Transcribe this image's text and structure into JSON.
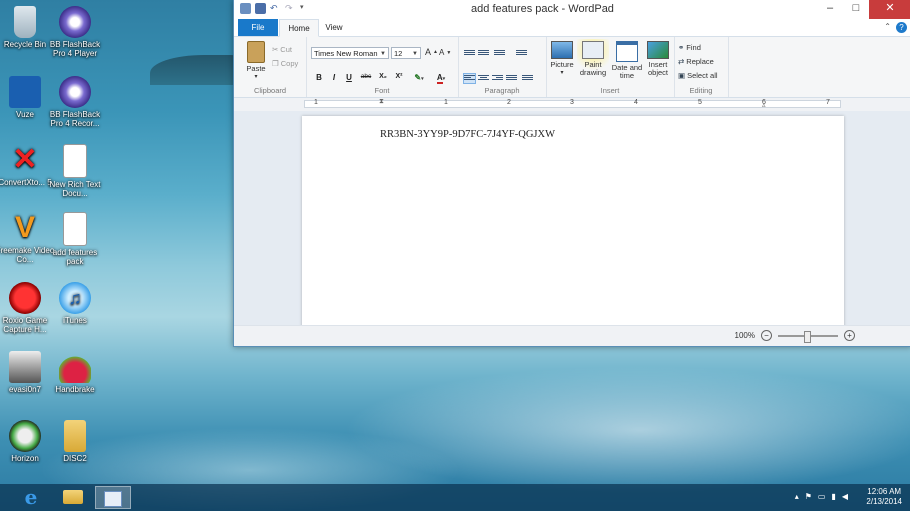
{
  "desktop": {
    "icons": [
      {
        "label": "Recycle Bin"
      },
      {
        "label": "BB FlashBack Pro 4 Player"
      },
      {
        "label": "Vuze"
      },
      {
        "label": "BB FlashBack Pro 4 Recor..."
      },
      {
        "label": "ConvertXto... 5"
      },
      {
        "label": "New Rich Text Docu..."
      },
      {
        "label": "Freemake Video Co..."
      },
      {
        "label": "add features pack"
      },
      {
        "label": "Roxio Game Capture H..."
      },
      {
        "label": "iTunes"
      },
      {
        "label": "evasi0n7"
      },
      {
        "label": "Handbrake"
      },
      {
        "label": "Horizon"
      },
      {
        "label": "DISC2"
      }
    ]
  },
  "window": {
    "title": "add features pack - WordPad",
    "tabs": {
      "file": "File",
      "home": "Home",
      "view": "View"
    },
    "help": "?",
    "ribbon": {
      "clipboard": {
        "label": "Clipboard",
        "paste": "Paste",
        "cut": "Cut",
        "copy": "Copy"
      },
      "font": {
        "label": "Font",
        "family": "Times New Roman",
        "size": "12",
        "bold": "B",
        "italic": "I",
        "underline": "U",
        "strike": "abc",
        "sub": "X₂",
        "sup": "X²"
      },
      "paragraph": {
        "label": "Paragraph"
      },
      "insert": {
        "label": "Insert",
        "picture": "Picture",
        "paint1": "Paint",
        "paint2": "drawing",
        "date1": "Date and",
        "date2": "time",
        "object1": "Insert",
        "object2": "object"
      },
      "editing": {
        "label": "Editing",
        "find": "Find",
        "replace": "Replace",
        "select_all": "Select all"
      }
    },
    "ruler": [
      "1",
      "1",
      "2",
      "3",
      "4",
      "5",
      "6",
      "7"
    ],
    "document_text": "RR3BN-3YY9P-9D7FC-7J4YF-QGJXW",
    "zoom": "100%"
  },
  "taskbar": {
    "time": "12:06 AM",
    "date": "2/13/2014"
  },
  "colors": {
    "accent": "#1979ca",
    "close": "#c83c3c"
  }
}
